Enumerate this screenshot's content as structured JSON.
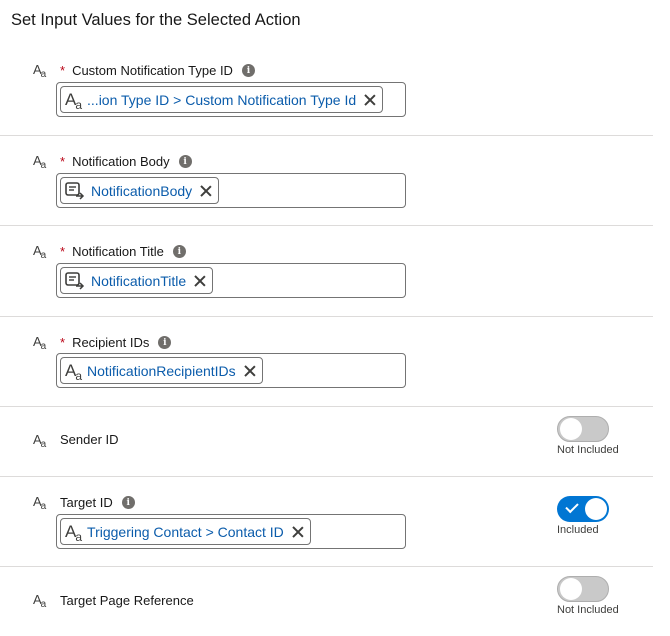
{
  "heading": "Set Input Values for the Selected Action",
  "type_icon": {
    "big": "A",
    "small": "a"
  },
  "required_marker": "*",
  "info_glyph": "i",
  "rows": [
    {
      "label": "Custom Notification Type ID",
      "required": true,
      "pill": "...ion Type ID > Custom Notification Type Id",
      "pill_icon": "text-icon"
    },
    {
      "label": "Notification Body",
      "required": true,
      "pill": "NotificationBody",
      "pill_icon": "variable-icon"
    },
    {
      "label": "Notification Title",
      "required": true,
      "pill": "NotificationTitle",
      "pill_icon": "variable-icon"
    },
    {
      "label": "Recipient IDs",
      "required": true,
      "pill": "NotificationRecipientIDs",
      "pill_icon": "text-icon"
    },
    {
      "label": "Sender ID",
      "required": false,
      "toggle": "off",
      "toggle_label": "Not Included"
    },
    {
      "label": "Target ID",
      "required": false,
      "pill": "Triggering Contact > Contact ID",
      "pill_icon": "text-icon",
      "toggle": "on",
      "toggle_label": "Included"
    },
    {
      "label": "Target Page Reference",
      "required": false,
      "toggle": "off",
      "toggle_label": "Not Included"
    }
  ]
}
